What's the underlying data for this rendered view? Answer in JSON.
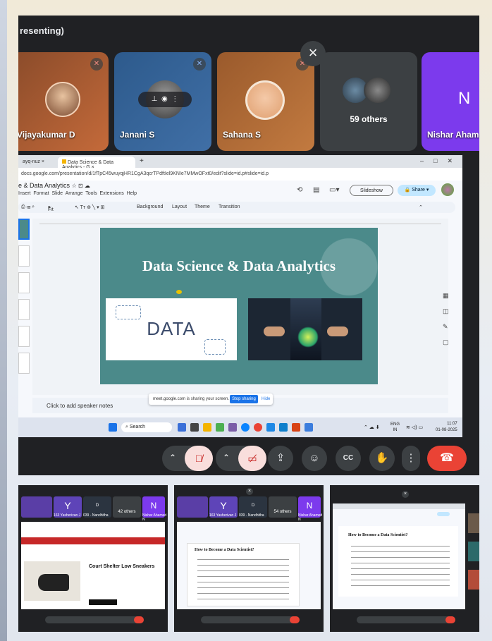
{
  "meet": {
    "presenting_label": "resenting)",
    "participants": [
      {
        "name": "Vijayakumar D"
      },
      {
        "name": "Janani S"
      },
      {
        "name": "Sahana S"
      },
      {
        "name": "59 others"
      },
      {
        "name": "Nishar Ahame",
        "initial": "N"
      }
    ]
  },
  "browser": {
    "tabs": [
      {
        "label": "ayq-nuz"
      },
      {
        "label": "Data Science & Data Analytics - G"
      }
    ],
    "url": "docs.google.com/presentation/d/1fTpC45wuyqjHR1CgA3qcrTPdftIel9KNIe7MMwOFxt0/edit?slide=id.p#slide=id.p",
    "doc_title": "e & Data Analytics",
    "menu": [
      "Insert",
      "Format",
      "Slide",
      "Arrange",
      "Tools",
      "Extensions",
      "Help"
    ],
    "slideshow_label": "Slideshow",
    "share_label": "Share",
    "toolbar": {
      "fit": "Fit",
      "background": "Background",
      "layout": "Layout",
      "theme": "Theme",
      "transition": "Transition"
    },
    "slide": {
      "title": "Data Science & Data Analytics",
      "data_word": "DATA"
    },
    "speaker_notes": "Click to add speaker notes",
    "share_notice": {
      "text": "meet.google.com is sharing your screen.",
      "stop": "Stop sharing",
      "hide": "Hide"
    },
    "taskbar": {
      "search": "Search",
      "lang": "ENG",
      "region": "IN",
      "time": "11:07",
      "date": "01-08-2025"
    }
  },
  "thumbnails": [
    {
      "tiles": [
        "Y",
        "D",
        "42 others",
        "N"
      ],
      "tile_names": [
        "163 Yasherivan J",
        "039 - Nandhitha",
        "",
        "Nishar Ahamed N"
      ],
      "content_title": "Court Shelter Low Sneakers"
    },
    {
      "tiles": [
        "Y",
        "D",
        "54 others",
        "N"
      ],
      "tile_names": [
        "163 Yasherivan J",
        "039 - Nandhitha",
        "",
        "Nishar Ahamed N"
      ],
      "content_title": "How to Become a Data Scientist?"
    },
    {
      "tiles": [],
      "tile_names": [],
      "content_title": "How to Become a Data Scientist?"
    }
  ],
  "colors": {
    "meet_bg": "#202124",
    "end_call": "#ea4335",
    "slide_bg": "#4b8a8a",
    "share_blue": "#1a73e8"
  }
}
